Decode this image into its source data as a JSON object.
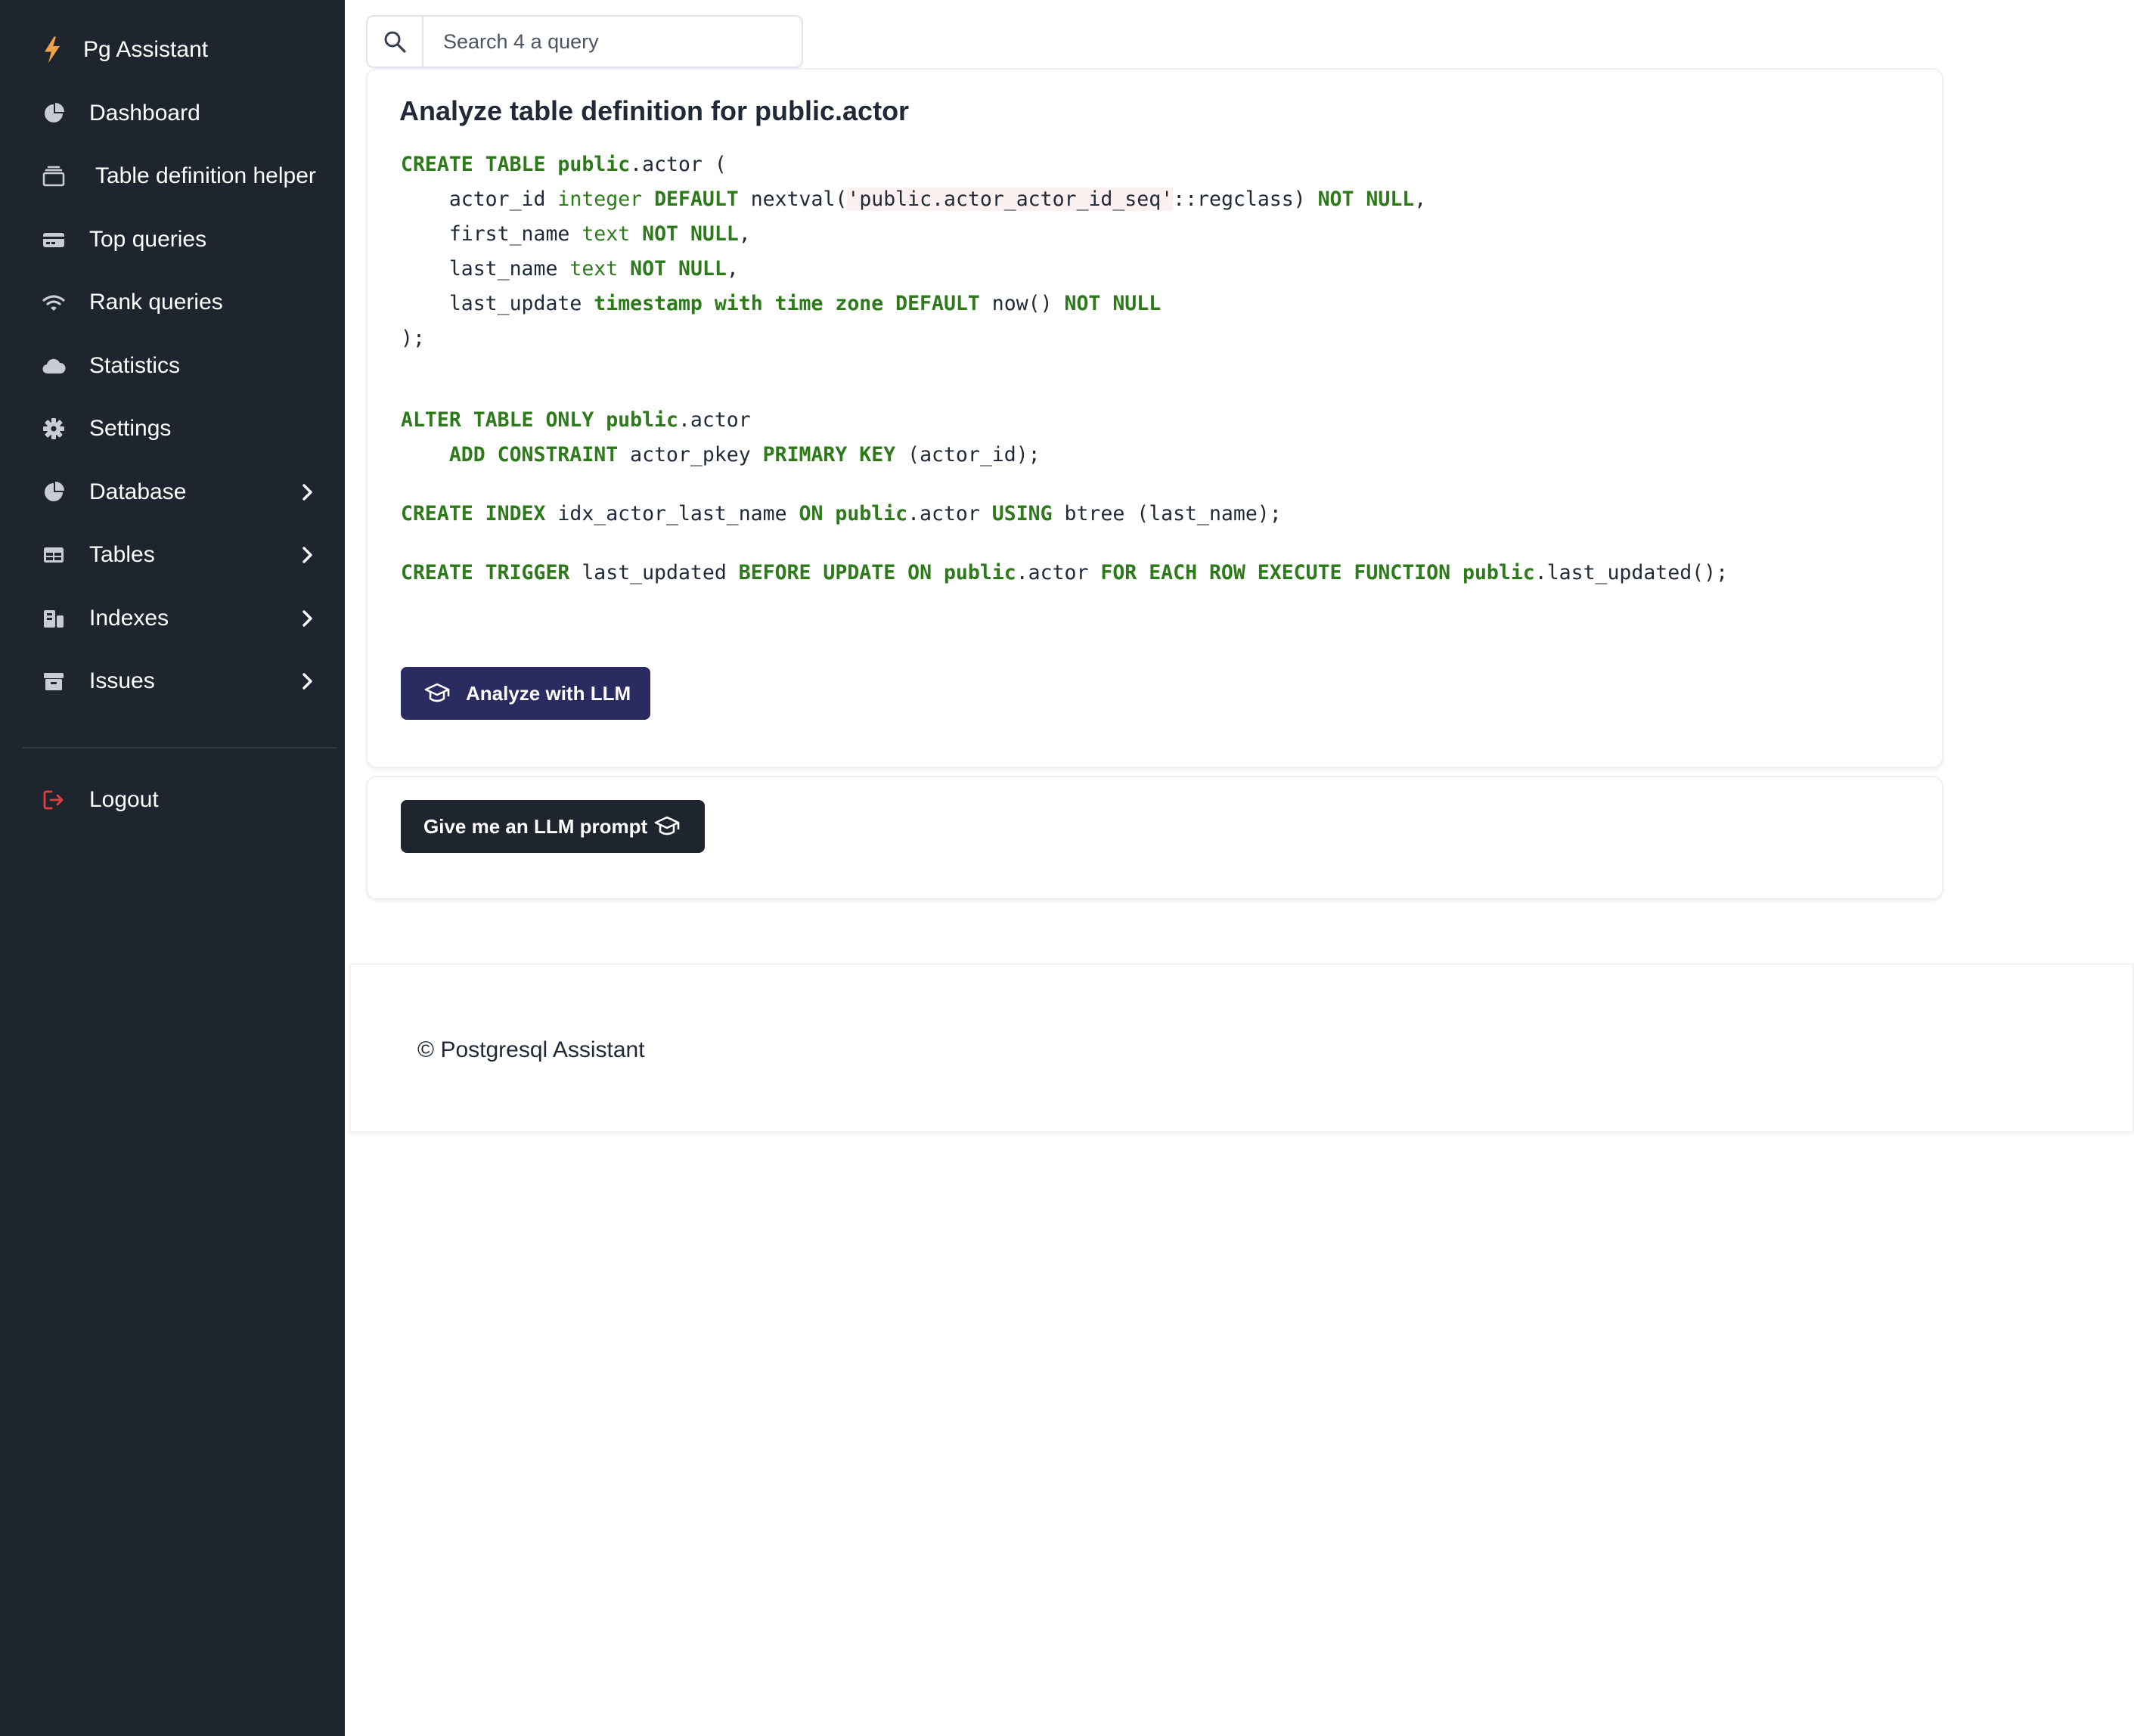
{
  "app": {
    "name": "Pg Assistant"
  },
  "sidebar": {
    "items": [
      {
        "label": "Dashboard",
        "icon": "pie-chart-icon"
      },
      {
        "label": "Table definition helper",
        "icon": "layers-icon"
      },
      {
        "label": "Top queries",
        "icon": "card-icon"
      },
      {
        "label": "Rank queries",
        "icon": "wifi-icon"
      },
      {
        "label": "Statistics",
        "icon": "cloud-icon"
      },
      {
        "label": "Settings",
        "icon": "gear-icon"
      },
      {
        "label": "Database",
        "icon": "pie-chart-icon",
        "expandable": true
      },
      {
        "label": "Tables",
        "icon": "table-icon",
        "expandable": true
      },
      {
        "label": "Indexes",
        "icon": "index-icon",
        "expandable": true
      },
      {
        "label": "Issues",
        "icon": "archive-icon",
        "expandable": true
      }
    ],
    "logout_label": "Logout"
  },
  "search": {
    "placeholder": "Search 4 a query",
    "value": ""
  },
  "main": {
    "title": "Analyze table definition for public.actor",
    "code": {
      "l1": {
        "a": "CREATE TABLE",
        "b": "public",
        "c": ".actor ("
      },
      "l2": {
        "a": "    actor_id ",
        "b": "integer",
        "c": "DEFAULT",
        "d": " nextval(",
        "e": "'public.actor_actor_id_seq'",
        "f": "::regclass) ",
        "g": "NOT NULL",
        "h": ","
      },
      "l3": {
        "a": "    first_name ",
        "b": "text",
        "c": "NOT NULL",
        "d": ","
      },
      "l4": {
        "a": "    last_name ",
        "b": "text",
        "c": "NOT NULL",
        "d": ","
      },
      "l5": {
        "a": "    last_update ",
        "b": "timestamp with time zone DEFAULT",
        "c": " now() ",
        "d": "NOT NULL"
      },
      "l6": {
        "a": ");"
      },
      "l7": {
        "a": "ALTER TABLE ONLY public",
        "b": ".actor"
      },
      "l8": {
        "a": "    ",
        "b": "ADD CONSTRAINT",
        "c": " actor_pkey ",
        "d": "PRIMARY KEY",
        "e": " (actor_id);"
      },
      "l9": {
        "a": "CREATE INDEX",
        "b": " idx_actor_last_name ",
        "c": "ON public",
        "d": ".actor ",
        "e": "USING",
        "f": " btree (last_name);"
      },
      "l10": {
        "a": "CREATE TRIGGER",
        "b": " last_updated ",
        "c": "BEFORE UPDATE ON public",
        "d": ".actor ",
        "e": "FOR EACH ROW EXECUTE FUNCTION public",
        "f": ".last_updated();"
      }
    },
    "analyze_button": "Analyze with LLM",
    "prompt_button": "Give me an LLM prompt"
  },
  "footer": {
    "text": "© Postgresql Assistant"
  },
  "colors": {
    "sidebar_bg": "#1e252e",
    "keyword": "#2d7a1b",
    "analyze_button_bg": "#2a2b60",
    "prompt_button_bg": "#1e252e",
    "logout_icon": "#e0413e",
    "brand_bolt": "#f0a24b"
  }
}
